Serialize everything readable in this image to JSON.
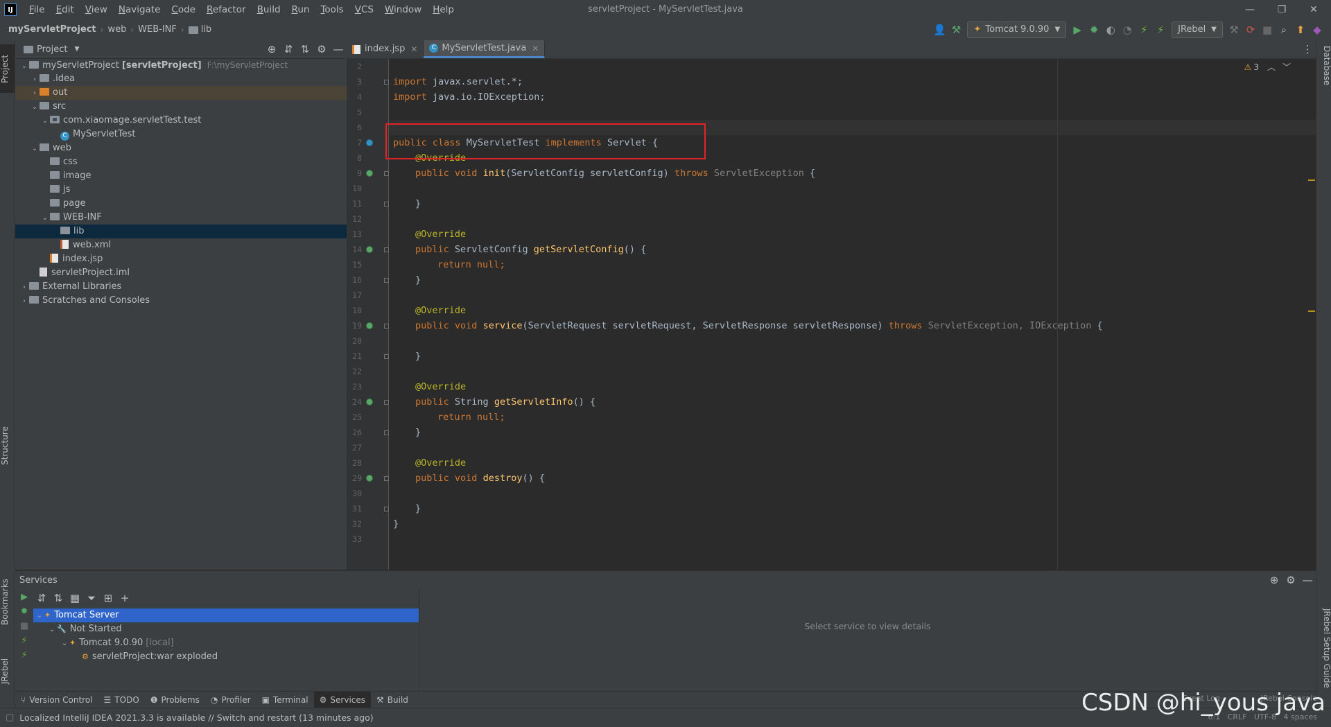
{
  "window": {
    "logo": "IJ",
    "title": "servletProject - MyServletTest.java",
    "controls": [
      "—",
      "❐",
      "✕"
    ]
  },
  "menu": [
    {
      "mnemonic": "F",
      "rest": "ile"
    },
    {
      "mnemonic": "E",
      "rest": "dit"
    },
    {
      "mnemonic": "V",
      "rest": "iew"
    },
    {
      "mnemonic": "N",
      "rest": "avigate"
    },
    {
      "mnemonic": "C",
      "rest": "ode"
    },
    {
      "mnemonic": "R",
      "rest": "efactor"
    },
    {
      "mnemonic": "B",
      "rest": "uild"
    },
    {
      "mnemonic": "R",
      "rest": "un"
    },
    {
      "mnemonic": "T",
      "rest": "ools"
    },
    {
      "mnemonic": "V",
      "rest": "CS"
    },
    {
      "mnemonic": "W",
      "rest": "indow"
    },
    {
      "mnemonic": "H",
      "rest": "elp"
    }
  ],
  "breadcrumb": {
    "project": "myServletProject",
    "items": [
      "web",
      "WEB-INF",
      "lib"
    ]
  },
  "toolbar": {
    "run_config": "Tomcat 9.0.90",
    "jrebel": "JRebel"
  },
  "stripes": {
    "project": "Project",
    "structure": "Structure",
    "bookmarks": "Bookmarks",
    "jrebel": "JRebel",
    "database": "Database",
    "jrebel_guide": "JRebel Setup Guide"
  },
  "project_panel": {
    "title": "Project",
    "tree": [
      {
        "text": "myServletProject",
        "bold": "[servletProject]",
        "muted": "F:\\myServletProject",
        "indent": 0,
        "arrow": "v",
        "icon": "folder"
      },
      {
        "text": ".idea",
        "indent": 1,
        "arrow": ">",
        "icon": "folder"
      },
      {
        "text": "out",
        "indent": 1,
        "arrow": ">",
        "icon": "folder-orange"
      },
      {
        "text": "src",
        "indent": 1,
        "arrow": "v",
        "icon": "folder"
      },
      {
        "text": "com.xiaomage.servletTest.test",
        "indent": 2,
        "arrow": "v",
        "icon": "package"
      },
      {
        "text": "MyServletTest",
        "indent": 3,
        "arrow": "",
        "icon": "class"
      },
      {
        "text": "web",
        "indent": 1,
        "arrow": "v",
        "icon": "folder"
      },
      {
        "text": "css",
        "indent": 2,
        "arrow": "",
        "icon": "folder"
      },
      {
        "text": "image",
        "indent": 2,
        "arrow": "",
        "icon": "folder"
      },
      {
        "text": "js",
        "indent": 2,
        "arrow": "",
        "icon": "folder"
      },
      {
        "text": "page",
        "indent": 2,
        "arrow": "",
        "icon": "folder"
      },
      {
        "text": "WEB-INF",
        "indent": 2,
        "arrow": "v",
        "icon": "folder"
      },
      {
        "text": "lib",
        "indent": 3,
        "arrow": "",
        "icon": "folder"
      },
      {
        "text": "web.xml",
        "indent": 3,
        "arrow": "",
        "icon": "xml"
      },
      {
        "text": "index.jsp",
        "indent": 2,
        "arrow": "",
        "icon": "jsp"
      },
      {
        "text": "servletProject.iml",
        "indent": 1,
        "arrow": "",
        "icon": "iml"
      },
      {
        "text": "External Libraries",
        "indent": 0,
        "arrow": ">",
        "icon": "libs"
      },
      {
        "text": "Scratches and Consoles",
        "indent": 0,
        "arrow": ">",
        "icon": "scratch"
      }
    ],
    "highlighted_row": "out",
    "selected_row": "lib"
  },
  "editor": {
    "tabs": [
      {
        "label": "index.jsp",
        "active": false
      },
      {
        "label": "MyServletTest.java",
        "active": true
      }
    ],
    "warnings": "3",
    "line_numbers": [
      "2",
      "3",
      "4",
      "5",
      "6",
      "7",
      "8",
      "9",
      "10",
      "11",
      "12",
      "13",
      "14",
      "15",
      "16",
      "17",
      "18",
      "19",
      "20",
      "21",
      "22",
      "23",
      "24",
      "25",
      "26",
      "27",
      "28",
      "29",
      "30",
      "31",
      "32",
      "33"
    ],
    "code": {
      "l3": [
        "import",
        "javax.servlet.*;"
      ],
      "l4": [
        "import",
        "java.io.IOException;"
      ],
      "l7": [
        "public",
        "class",
        "MyServletTest",
        "implements",
        "Servlet {"
      ],
      "l8": "@Override",
      "l9": [
        "public",
        "void",
        "init",
        "(ServletConfig servletConfig)",
        "throws",
        "ServletException",
        " {"
      ],
      "l11": "}",
      "l13": "@Override",
      "l14": [
        "public",
        "ServletConfig",
        "getServletConfig",
        "() {"
      ],
      "l15": [
        "return",
        "null",
        ";"
      ],
      "l16": "}",
      "l18": "@Override",
      "l19": [
        "public",
        "void",
        "service",
        "(ServletRequest servletRequest, ServletResponse servletResponse)",
        "throws",
        "ServletException, IOException",
        " {"
      ],
      "l21": "}",
      "l23": "@Override",
      "l24": [
        "public",
        "String",
        "getServletInfo",
        "() {"
      ],
      "l25": [
        "return",
        "null",
        ";"
      ],
      "l26": "}",
      "l28": "@Override",
      "l29": [
        "public",
        "void",
        "destroy",
        "() {"
      ],
      "l31": "}",
      "l32": "}"
    }
  },
  "services": {
    "title": "Services",
    "tree": [
      {
        "text": "Tomcat Server",
        "indent": 0,
        "arrow": "v",
        "selected": true
      },
      {
        "text": "Not Started",
        "indent": 1,
        "arrow": "v",
        "selected": false
      },
      {
        "text": "Tomcat 9.0.90",
        "muted": "[local]",
        "indent": 2,
        "arrow": "v",
        "selected": false
      },
      {
        "text": "servletProject:war exploded",
        "indent": 3,
        "arrow": "",
        "selected": false
      }
    ],
    "detail_placeholder": "Select service to view details"
  },
  "bottom_tools": [
    {
      "label": "Version Control",
      "icon": "⑂",
      "active": false
    },
    {
      "label": "TODO",
      "icon": "☰",
      "active": false
    },
    {
      "label": "Problems",
      "icon": "❶",
      "active": false
    },
    {
      "label": "Profiler",
      "icon": "◔",
      "active": false
    },
    {
      "label": "Terminal",
      "icon": "▣",
      "active": false
    },
    {
      "label": "Services",
      "icon": "⚙",
      "active": true
    },
    {
      "label": "Build",
      "icon": "⚒",
      "active": false
    }
  ],
  "status": {
    "message": "Localized IntelliJ IDEA 2021.3.3 is available // Switch and restart (13 minutes ago)",
    "right": "6:1   CRLF   UTF-8   4 spaces",
    "event_log": "Event Log",
    "jrebel_console": "JRebel Console"
  },
  "watermark": "CSDN @hi_yous java",
  "colors": {
    "keyword": "#cc7832",
    "annotation": "#bbb529",
    "method": "#ffc66d",
    "highlight_box": "#e52222",
    "selection": "#2f65ca"
  }
}
